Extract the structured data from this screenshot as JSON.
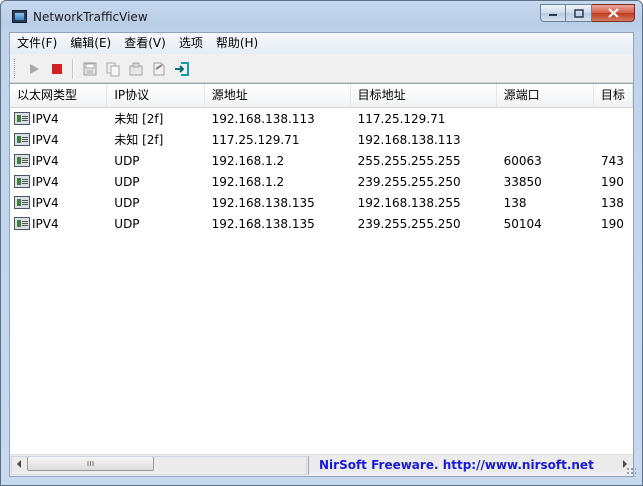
{
  "window": {
    "title": "NetworkTrafficView",
    "buttons": {
      "minimize": "▁",
      "maximize": "□",
      "close": "✕"
    }
  },
  "menu": [
    "文件(F)",
    "编辑(E)",
    "查看(V)",
    "选项",
    "帮助(H)"
  ],
  "toolbar": {
    "icons": [
      "play-icon",
      "stop-icon",
      "save-icon",
      "copy-icon",
      "properties-icon",
      "report-icon",
      "exit-icon"
    ]
  },
  "table": {
    "columns": [
      "以太网类型",
      "IP协议",
      "源地址",
      "目标地址",
      "源端口",
      "目标"
    ],
    "rows": [
      [
        "IPV4",
        "未知 [2f]",
        "192.168.138.113",
        "117.25.129.71",
        "",
        ""
      ],
      [
        "IPV4",
        "未知 [2f]",
        "117.25.129.71",
        "192.168.138.113",
        "",
        ""
      ],
      [
        "IPV4",
        "UDP",
        "192.168.1.2",
        "255.255.255.255",
        "60063",
        "743"
      ],
      [
        "IPV4",
        "UDP",
        "192.168.1.2",
        "239.255.255.250",
        "33850",
        "190"
      ],
      [
        "IPV4",
        "UDP",
        "192.168.138.135",
        "192.168.138.255",
        "138",
        "138"
      ],
      [
        "IPV4",
        "UDP",
        "192.168.138.135",
        "239.255.255.250",
        "50104",
        "190"
      ]
    ]
  },
  "status": {
    "text": "NirSoft Freeware.  http://www.nirsoft.net"
  },
  "colors": {
    "stop_red": "#d42020",
    "link_blue": "#1a1ad6",
    "teal_exit": "#149ca3"
  }
}
